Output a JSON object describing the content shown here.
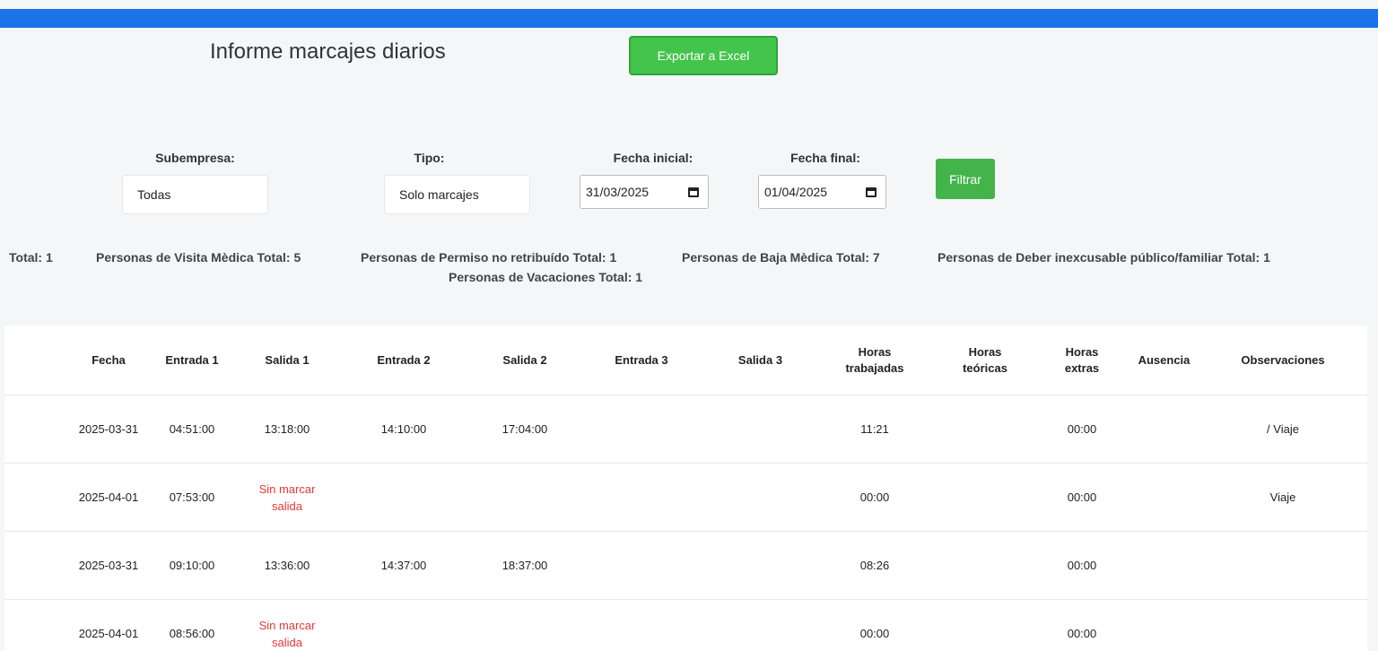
{
  "header": {
    "title": "Informe marcajes diarios",
    "export_label": "Exportar a Excel"
  },
  "filters": {
    "subempresa_label": "Subempresa:",
    "subempresa_value": "Todas",
    "tipo_label": "Tipo:",
    "tipo_value": "Solo marcajes",
    "fecha_inicial_label": "Fecha inicial:",
    "fecha_inicial_value": "31/03/2025",
    "fecha_final_label": "Fecha final:",
    "fecha_final_value": "01/04/2025",
    "filter_label": "Filtrar"
  },
  "totals": [
    "Total: 1",
    "Personas de Visita Mèdica Total: 5",
    "Personas de Permiso no retribuído Total: 1",
    "Personas de Vacaciones Total: 1",
    "Personas de Baja Mèdica Total: 7",
    "Personas de Deber inexcusable público/familiar Total: 1"
  ],
  "table": {
    "headers": [
      "Fecha",
      "Entrada 1",
      "Salida 1",
      "Entrada 2",
      "Salida 2",
      "Entrada 3",
      "Salida 3",
      "Horas trabajadas",
      "Horas teóricas",
      "Horas extras",
      "Ausencia",
      "Observaciones"
    ],
    "rows": [
      [
        "2025-03-31",
        "04:51:00",
        "13:18:00",
        "14:10:00",
        "17:04:00",
        "",
        "",
        "11:21",
        "",
        "00:00",
        "",
        "/ Viaje"
      ],
      [
        "2025-04-01",
        "07:53:00",
        "Sin marcar salida",
        "",
        "",
        "",
        "",
        "00:00",
        "",
        "00:00",
        "",
        "Viaje"
      ],
      [
        "2025-03-31",
        "09:10:00",
        "13:36:00",
        "14:37:00",
        "18:37:00",
        "",
        "",
        "08:26",
        "",
        "00:00",
        "",
        ""
      ],
      [
        "2025-04-01",
        "08:56:00",
        "Sin marcar salida",
        "",
        "",
        "",
        "",
        "00:00",
        "",
        "00:00",
        "",
        ""
      ]
    ]
  },
  "colors": {
    "topbar": "#1a73e8",
    "export_button": "#43c44b",
    "filter_button": "#43b449",
    "missing_text": "#e53935"
  }
}
